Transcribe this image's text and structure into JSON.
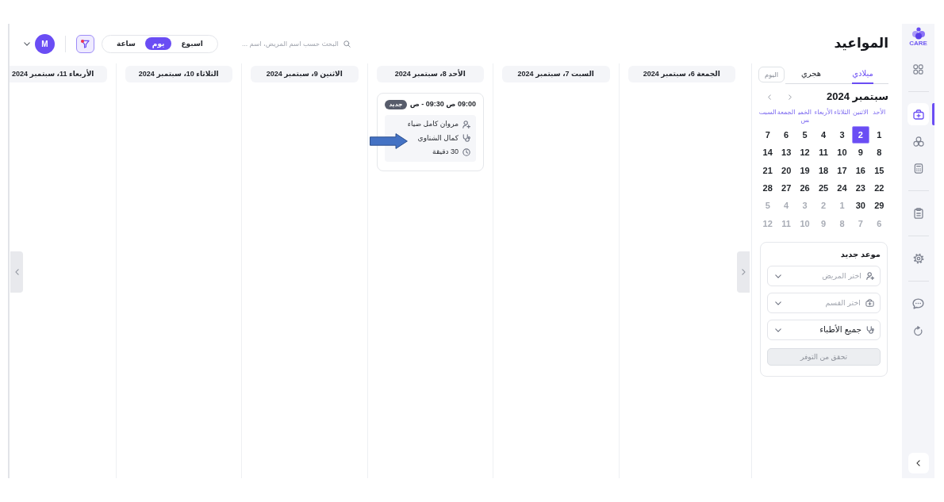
{
  "sidebar": {
    "logo_text": "CARE",
    "groups": [
      {
        "items": [
          {
            "selected": false
          }
        ]
      },
      {
        "items": [
          {
            "selected": true
          },
          {
            "selected": false
          },
          {
            "selected": false
          }
        ]
      },
      {
        "items": [
          {
            "selected": false
          }
        ]
      },
      {
        "items": [
          {
            "selected": false
          }
        ]
      },
      {
        "items": [
          {
            "selected": false
          },
          {
            "selected": false
          }
        ]
      }
    ]
  },
  "header": {
    "title": "المواعيد",
    "search": {
      "placeholder": "البحث حسب اسم المريض، اسم ..."
    },
    "views": [
      {
        "label": "اسبوع",
        "selected": false
      },
      {
        "label": "يوم",
        "selected": true
      },
      {
        "label": "ساعة",
        "selected": false
      }
    ],
    "filter": {
      "active": true
    },
    "user": {
      "initial": "M"
    }
  },
  "calendar": {
    "tabs": [
      {
        "label": "ميلادي",
        "selected": true
      },
      {
        "label": "هجري",
        "selected": false
      }
    ],
    "today_button": "اليوم",
    "month": "سبتمبر 2024",
    "weekdays": [
      "الأحد",
      "الاثنين",
      "الثلاثاء",
      "الأربعاء",
      "الخميس",
      "الجمعة",
      "السبت"
    ],
    "dates": [
      {
        "day": "1",
        "muted": false,
        "selected": false
      },
      {
        "day": "2",
        "muted": false,
        "selected": true
      },
      {
        "day": "3",
        "muted": false,
        "selected": false
      },
      {
        "day": "4",
        "muted": false,
        "selected": false
      },
      {
        "day": "5",
        "muted": false,
        "selected": false
      },
      {
        "day": "6",
        "muted": false,
        "selected": false
      },
      {
        "day": "7",
        "muted": false,
        "selected": false
      },
      {
        "day": "8",
        "muted": false,
        "selected": false
      },
      {
        "day": "9",
        "muted": false,
        "selected": false
      },
      {
        "day": "10",
        "muted": false,
        "selected": false
      },
      {
        "day": "11",
        "muted": false,
        "selected": false
      },
      {
        "day": "12",
        "muted": false,
        "selected": false
      },
      {
        "day": "13",
        "muted": false,
        "selected": false
      },
      {
        "day": "14",
        "muted": false,
        "selected": false
      },
      {
        "day": "15",
        "muted": false,
        "selected": false
      },
      {
        "day": "16",
        "muted": false,
        "selected": false
      },
      {
        "day": "17",
        "muted": false,
        "selected": false
      },
      {
        "day": "18",
        "muted": false,
        "selected": false
      },
      {
        "day": "19",
        "muted": false,
        "selected": false
      },
      {
        "day": "20",
        "muted": false,
        "selected": false
      },
      {
        "day": "21",
        "muted": false,
        "selected": false
      },
      {
        "day": "22",
        "muted": false,
        "selected": false
      },
      {
        "day": "23",
        "muted": false,
        "selected": false
      },
      {
        "day": "24",
        "muted": false,
        "selected": false
      },
      {
        "day": "25",
        "muted": false,
        "selected": false
      },
      {
        "day": "26",
        "muted": false,
        "selected": false
      },
      {
        "day": "27",
        "muted": false,
        "selected": false
      },
      {
        "day": "28",
        "muted": false,
        "selected": false
      },
      {
        "day": "29",
        "muted": false,
        "selected": false
      },
      {
        "day": "30",
        "muted": false,
        "selected": false
      },
      {
        "day": "1",
        "muted": true,
        "selected": false
      },
      {
        "day": "2",
        "muted": true,
        "selected": false
      },
      {
        "day": "3",
        "muted": true,
        "selected": false
      },
      {
        "day": "4",
        "muted": true,
        "selected": false
      },
      {
        "day": "5",
        "muted": true,
        "selected": false
      },
      {
        "day": "6",
        "muted": true,
        "selected": false
      },
      {
        "day": "7",
        "muted": true,
        "selected": false
      },
      {
        "day": "8",
        "muted": true,
        "selected": false
      },
      {
        "day": "9",
        "muted": true,
        "selected": false
      },
      {
        "day": "10",
        "muted": true,
        "selected": false
      },
      {
        "day": "11",
        "muted": true,
        "selected": false
      },
      {
        "day": "12",
        "muted": true,
        "selected": false
      }
    ]
  },
  "new_appointment": {
    "title": "موعد جديد",
    "fields": [
      {
        "placeholder": "اختر المريض"
      },
      {
        "placeholder": "اختر القسم"
      },
      {
        "value": "جميع الأطباء"
      }
    ],
    "button": {
      "label": "تحقق من التوفر",
      "disabled": true
    }
  },
  "days": [
    {
      "header": "الجمعة 6، سبتمبر 2024"
    },
    {
      "header": "السبت 7، سبتمبر 2024"
    },
    {
      "header": "الأحد 8، سبتمبر 2024",
      "appointments": [
        {
          "time": "09:00 ص 09:30 - ص",
          "badge": "جديد",
          "patient": "مروان كامل ضياء",
          "doctor": "كمال الشناوي",
          "duration": "30 دقيقة"
        }
      ]
    },
    {
      "header": "الاثنين 9، سبتمبر 2024"
    },
    {
      "header": "الثلاثاء 10، سبتمبر 2024"
    },
    {
      "header": "الأربعاء 11، سبتمبر 2024"
    }
  ]
}
